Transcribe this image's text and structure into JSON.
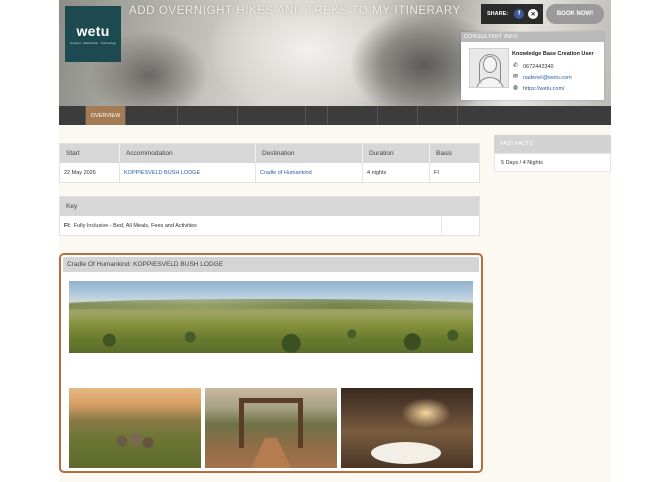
{
  "header": {
    "logo_text": "wetu",
    "logo_tagline": "Content · Distribution · Technology",
    "title": "ADD OVERNIGHT HIKES AND TREKS TO MY ITINERARY",
    "share_label": "SHARE:",
    "book_button": "BOOK NOW!"
  },
  "consultant": {
    "heading": "CONSULTANT INFO",
    "name": "Knowledge Base Creation User",
    "phone": "0672442340",
    "email": "nadenel@wetu.com",
    "website": "https://wetu.com/"
  },
  "nav": {
    "tabs": [
      {
        "label": "OVERVIEW",
        "active": true
      },
      {
        "label": ""
      },
      {
        "label": ""
      },
      {
        "label": ""
      },
      {
        "label": ""
      },
      {
        "label": ""
      },
      {
        "label": ""
      },
      {
        "label": ""
      },
      {
        "label": ""
      }
    ]
  },
  "itinerary": {
    "columns": [
      "Start",
      "Accommodation",
      "Destination",
      "Duration",
      "Basis"
    ],
    "rows": [
      {
        "start": "22 May 2026",
        "accommodation": "KOPPIESVELD BUSH LODGE",
        "destination": "Cradle of Humankind",
        "duration": "4 nights",
        "basis": "FI"
      }
    ]
  },
  "key": {
    "heading": "Key",
    "code": "FI:",
    "description": "Fully Inclusive - Bed, All Meals, Fees and Activities"
  },
  "fast_facts": {
    "heading": "FAST FACTS",
    "value": "5 Days / 4 Nights"
  },
  "lodge": {
    "caption": "Cradle Of Humankind: KOPPIESVELD BUSH LODGE"
  }
}
